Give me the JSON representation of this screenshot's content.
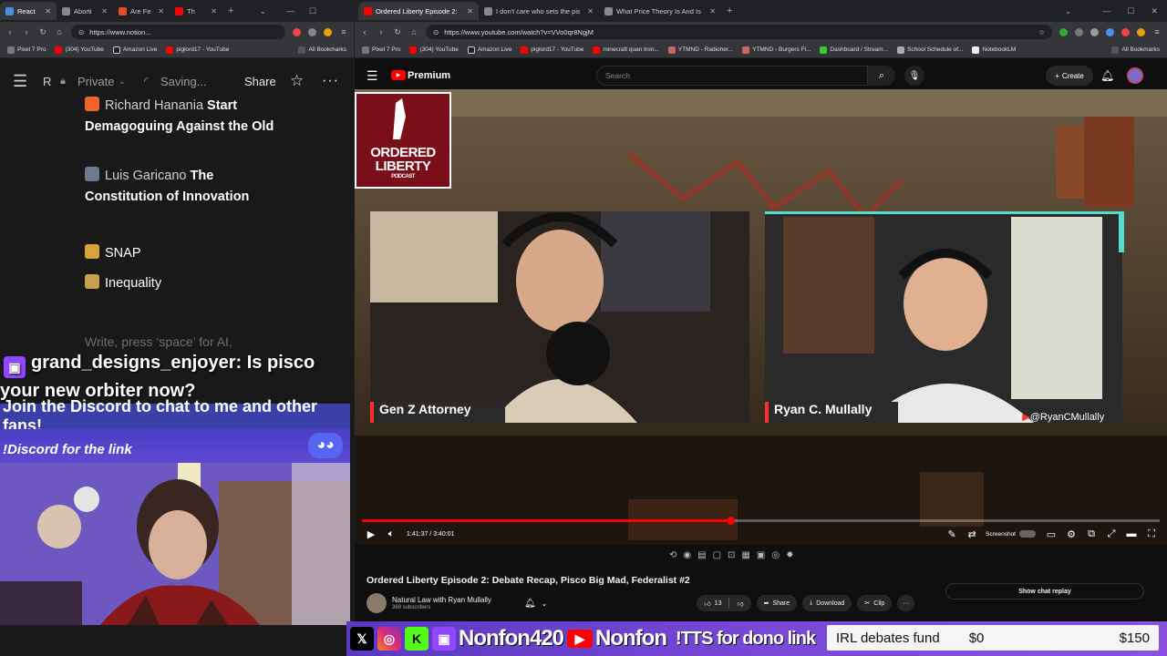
{
  "left_browser": {
    "tabs": [
      {
        "label": "React",
        "color": "#4a90e2"
      },
      {
        "label": "Aborti",
        "color": "#888888"
      },
      {
        "label": "Are Fe",
        "color": "#e44d26"
      },
      {
        "label": "Th",
        "color": "#ff0000"
      }
    ],
    "url": "https://www.notion...",
    "bookmarks": [
      "Pixel 7 Pro",
      "(304) YouTube",
      "Amazon Live",
      "piglord17 - YouTube",
      "All Bookmarks"
    ]
  },
  "notion": {
    "privacy": "Private",
    "status": "Saving...",
    "share_label": "Share",
    "truncated_title": "R",
    "items": [
      {
        "author": "Richard Hanania",
        "title": "Start Demagoguing Against the Old"
      },
      {
        "author": "Luis Garicano",
        "title": "The Constitution of Innovation"
      }
    ],
    "topics": [
      "SNAP",
      "Inequality"
    ],
    "placeholder": "Write, press ‘space’ for AI,"
  },
  "stream_overlay": {
    "chat_user": "grand_designs_enjoyer:",
    "chat_message": "Is pisco your new orbiter now?",
    "discord_banner": "Join the Discord to chat to me and other fans!",
    "discord_command": "!Discord for the link"
  },
  "right_browser": {
    "tabs": [
      {
        "label": "Ordered Liberty Episode 2: Deb",
        "color": "#ff0000"
      },
      {
        "label": "I don't care who sets the pisco",
        "color": "#888888"
      },
      {
        "label": "What Price Theory Is And Is No",
        "color": "#888888"
      }
    ],
    "url": "https://www.youtube.com/watch?v=VVo0qr8NgjM",
    "bookmarks": [
      "Pixel 7 Pro",
      "(304) YouTube",
      "Amazon Live",
      "piglord17 - YouTube",
      "minecraft quan tron...",
      "YTMND - Radioher...",
      "YTMND - Burgers Fl...",
      "Dashboard / Stream...",
      "School Schedule of...",
      "NotebookLM",
      "All Bookmarks"
    ]
  },
  "youtube": {
    "logo_text": "Premium",
    "search_placeholder": "Search",
    "create_label": "Create",
    "podcast_logo_line1": "ORDERED",
    "podcast_logo_line2": "LIBERTY",
    "podcast_logo_line3": "PODCAST",
    "speaker_left": "Gen Z Attorney",
    "speaker_right": "Ryan C. Mullally",
    "handle": "@RyanCMullally",
    "time": "1:41:37 / 3:40:01",
    "progress": 0.462,
    "screenshot_label": "Screenshot",
    "video_title": "Ordered Liberty Episode 2: Debate Recap, Pisco Big Mad, Federalist #2",
    "channel_name": "Natural Law with Ryan Mullally",
    "subscribers": "369 subscribers",
    "likes": "13",
    "share_label": "Share",
    "download_label": "Download",
    "clip_label": "Clip",
    "chat_replay_label": "Show chat replay"
  },
  "ticker": {
    "handle1": "Nonfon420",
    "handle2": "Nonfon",
    "tts_text": "!TTS for dono link",
    "fund_label": "IRL debates fund",
    "fund_current": "$0",
    "fund_goal": "$150"
  },
  "colors": {
    "youtube_red": "#ff0000",
    "twitch_purple": "#9146ff",
    "discord_blurple": "#5865f2"
  }
}
